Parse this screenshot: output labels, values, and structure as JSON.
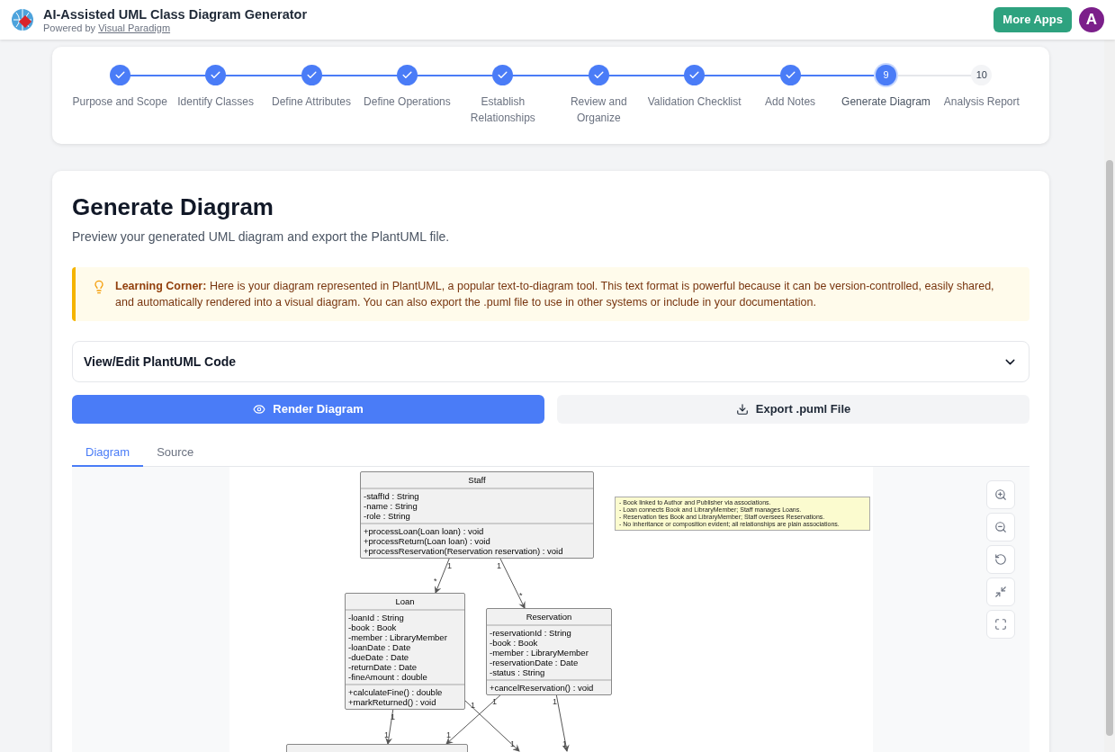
{
  "header": {
    "title": "AI-Assisted UML Class Diagram Generator",
    "powered_by": "Powered by",
    "powered_link": "Visual Paradigm",
    "more_apps": "More Apps",
    "avatar": "A"
  },
  "steps": [
    {
      "label": "Purpose and Scope",
      "done": true,
      "selected": false
    },
    {
      "label": "Identify Classes",
      "done": true,
      "selected": false
    },
    {
      "label": "Define Attributes",
      "done": true,
      "selected": false
    },
    {
      "label": "Define Operations",
      "done": true,
      "selected": false
    },
    {
      "label": "Establish Relationships",
      "done": true,
      "selected": false
    },
    {
      "label": "Review and Organize",
      "done": true,
      "selected": false
    },
    {
      "label": "Validation Checklist",
      "done": true,
      "selected": false
    },
    {
      "label": "Add Notes",
      "done": true,
      "selected": false
    },
    {
      "label": "Generate Diagram",
      "done": false,
      "selected": true,
      "number": "9"
    },
    {
      "label": "Analysis Report",
      "done": false,
      "selected": false,
      "number": "10"
    }
  ],
  "page": {
    "title": "Generate Diagram",
    "subtitle": "Preview your generated UML diagram and export the PlantUML file."
  },
  "tip": {
    "text": "**Learning Corner:** Here is your diagram represented in PlantUML, a popular text-to-diagram tool. This text format is powerful because it can be version-controlled, easily shared, and automatically rendered into a visual diagram. You can also export the .puml file to use in other systems or include in your documentation."
  },
  "code_panel": {
    "label": "View/Edit PlantUML Code",
    "expanded": false
  },
  "buttons": [
    {
      "label": "Render Diagram",
      "kind": "primary"
    },
    {
      "label": "Export .puml File",
      "kind": "secondary"
    }
  ],
  "tabs": [
    {
      "label": "Diagram",
      "selected": true
    },
    {
      "label": "Source",
      "selected": false
    }
  ],
  "diagram": {
    "classes": [
      {
        "name": "Staff",
        "attributes": [
          "-staffId : String",
          "-name : String",
          "-role : String"
        ],
        "operations": [
          "+processLoan(Loan loan) : void",
          "+processReturn(Loan loan) : void",
          "+processReservation(Reservation reservation) : void"
        ]
      },
      {
        "name": "Loan",
        "attributes": [
          "-loanId : String",
          "-book : Book",
          "-member : LibraryMember",
          "-loanDate : Date",
          "-dueDate : Date",
          "-returnDate : Date",
          "-fineAmount : double"
        ],
        "operations": [
          "+calculateFine() : double",
          "+markReturned() : void"
        ]
      },
      {
        "name": "Reservation",
        "attributes": [
          "-reservationId : String",
          "-book : Book",
          "-member : LibraryMember",
          "-reservationDate : Date",
          "-status : String"
        ],
        "operations": [
          "+cancelReservation() : void"
        ]
      },
      {
        "kind": "cut"
      }
    ],
    "note": [
      "- Book linked to Author and Publisher via associations.",
      "- Loan connects Book and LibraryMember; Staff manages Loans.",
      "- Reservation ties Book and LibraryMember; Staff oversees Reservations.",
      "- No inheritance or composition evident; all relationships are plain associations."
    ],
    "associations": [
      {
        "source_label": "1",
        "target_label": "*"
      },
      {
        "source_label": "1",
        "target_label": "*"
      },
      {
        "source_label": "1",
        "target_label": "1"
      },
      {
        "source_label": "1",
        "target_label": "1"
      },
      {
        "source_label": "1",
        "target_label": "1"
      },
      {
        "source_label": "1",
        "target_label": "1"
      }
    ]
  }
}
